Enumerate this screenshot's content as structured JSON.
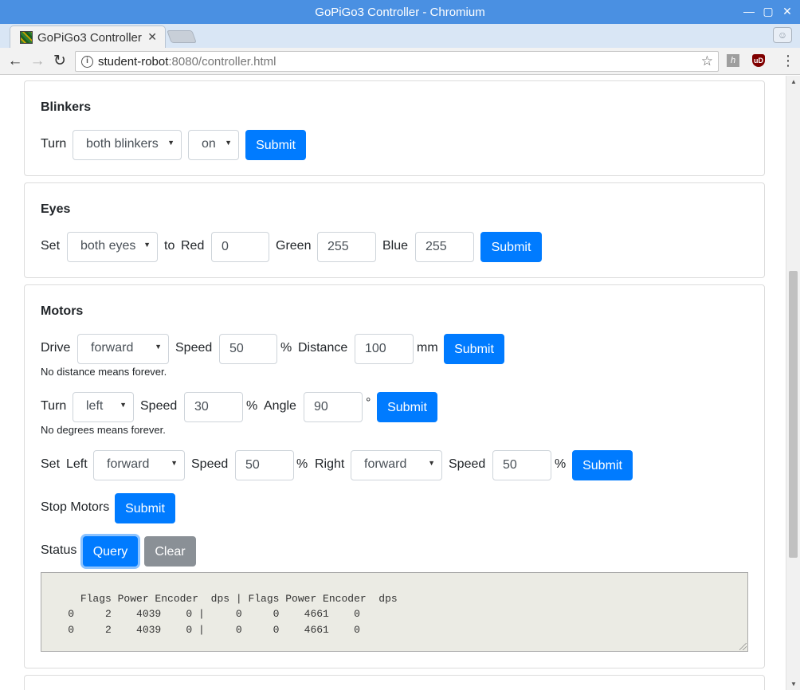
{
  "window": {
    "title": "GoPiGo3 Controller - Chromium"
  },
  "tab": {
    "label": "GoPiGo3 Controller"
  },
  "toolbar": {
    "url_host": "student-robot",
    "url_rest": ":8080/controller.html"
  },
  "blinkers": {
    "heading": "Blinkers",
    "turn_label": "Turn",
    "which": "both blinkers",
    "state": "on",
    "submit": "Submit"
  },
  "eyes": {
    "heading": "Eyes",
    "set_label": "Set",
    "which": "both eyes",
    "to_label": "to",
    "red_label": "Red",
    "red_value": "0",
    "green_label": "Green",
    "green_value": "255",
    "blue_label": "Blue",
    "blue_value": "255",
    "submit": "Submit"
  },
  "motors": {
    "heading": "Motors",
    "drive": {
      "label": "Drive",
      "direction": "forward",
      "speed_label": "Speed",
      "speed_value": "50",
      "percent": "%",
      "distance_label": "Distance",
      "distance_value": "100",
      "unit": "mm",
      "submit": "Submit",
      "hint": "No distance means forever."
    },
    "turn": {
      "label": "Turn",
      "direction": "left",
      "speed_label": "Speed",
      "speed_value": "30",
      "percent": "%",
      "angle_label": "Angle",
      "angle_value": "90",
      "unit": "°",
      "submit": "Submit",
      "hint": "No degrees means forever."
    },
    "set": {
      "set_label": "Set",
      "left_label": "Left",
      "left_direction": "forward",
      "left_speed_label": "Speed",
      "left_speed_value": "50",
      "left_percent": "%",
      "right_label": "Right",
      "right_direction": "forward",
      "right_speed_label": "Speed",
      "right_speed_value": "50",
      "right_percent": "%",
      "submit": "Submit"
    },
    "stop": {
      "label": "Stop Motors",
      "submit": "Submit"
    },
    "status": {
      "label": "Status",
      "query": "Query",
      "clear": "Clear",
      "output": "Flags Power Encoder  dps | Flags Power Encoder  dps\n    0     2    4039    0 |     0     0    4661    0\n    0     2    4039    0 |     0     0    4661    0"
    }
  },
  "colors": {
    "primary": "#007bff",
    "secondary": "#8a9096",
    "titlebar": "#4a90e2"
  }
}
